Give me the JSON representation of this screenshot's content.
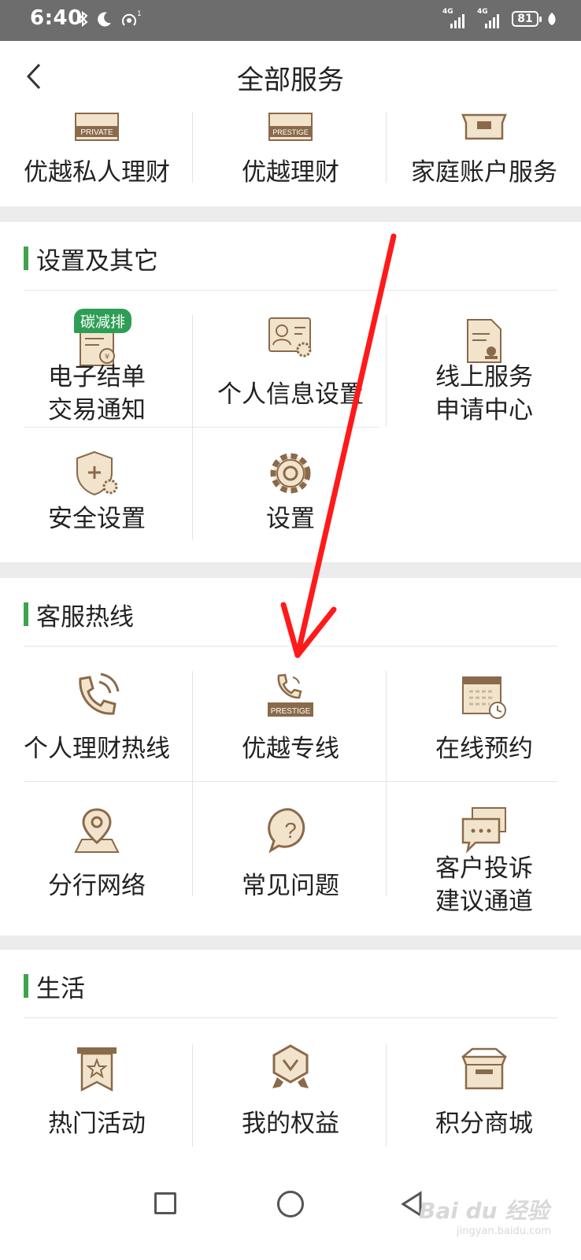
{
  "status": {
    "time": "6:40",
    "sig1": "4G",
    "sig2": "4G",
    "battery": "81"
  },
  "header": {
    "title": "全部服务"
  },
  "top_row": {
    "items": [
      {
        "label": "优越私人理财",
        "icon": "private-wealth-icon"
      },
      {
        "label": "优越理财",
        "icon": "prestige-wealth-icon"
      },
      {
        "label": "家庭账户服务",
        "icon": "family-account-icon"
      }
    ]
  },
  "settings": {
    "title": "设置及其它",
    "badge": "碳减排",
    "items": [
      {
        "line1": "电子结单",
        "line2": "交易通知",
        "icon": "e-statement-icon"
      },
      {
        "label": "个人信息设置",
        "icon": "profile-settings-icon"
      },
      {
        "line1": "线上服务",
        "line2": "申请中心",
        "icon": "online-service-icon"
      },
      {
        "label": "安全设置",
        "icon": "security-shield-icon"
      },
      {
        "label": "设置",
        "icon": "gear-icon"
      }
    ]
  },
  "hotline": {
    "title": "客服热线",
    "items": [
      {
        "label": "个人理财热线",
        "icon": "phone-icon"
      },
      {
        "label": "优越专线",
        "icon": "prestige-phone-icon"
      },
      {
        "label": "在线预约",
        "icon": "calendar-clock-icon"
      },
      {
        "label": "分行网络",
        "icon": "map-pin-icon"
      },
      {
        "label": "常见问题",
        "icon": "question-bubble-icon"
      },
      {
        "line1": "客户投诉",
        "line2": "建议通道",
        "icon": "complaint-chat-icon"
      }
    ]
  },
  "life": {
    "title": "生活",
    "items": [
      {
        "label": "热门活动",
        "icon": "star-banner-icon"
      },
      {
        "label": "我的权益",
        "icon": "rights-badge-icon"
      },
      {
        "label": "积分商城",
        "icon": "points-box-icon"
      }
    ]
  },
  "watermark": {
    "brand": "Bai du 经验",
    "url": "jingyan.baidu.com"
  },
  "colors": {
    "accent_green": "#3fa34d",
    "icon_brown": "#8a6a4a",
    "icon_fill": "#f2e4cc",
    "arrow_red": "#ff1a1a"
  }
}
